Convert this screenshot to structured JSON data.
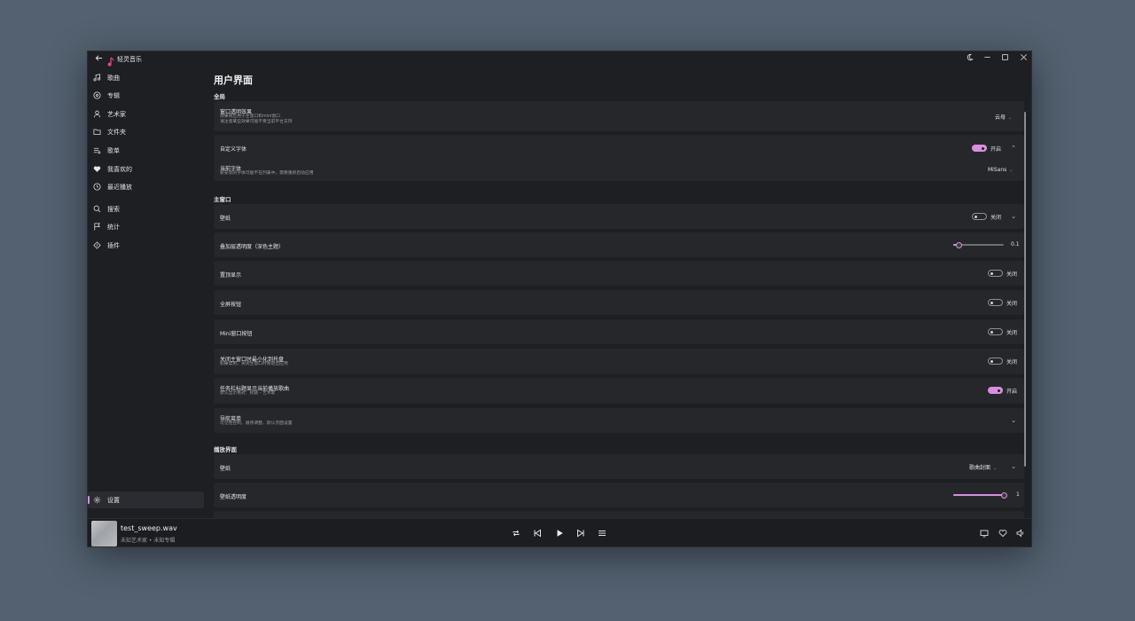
{
  "app": {
    "title": "轻灵音乐"
  },
  "sidebar": {
    "items": [
      {
        "label": "歌曲",
        "icon": "music-note-icon"
      },
      {
        "label": "专辑",
        "icon": "disc-icon"
      },
      {
        "label": "艺术家",
        "icon": "person-icon"
      },
      {
        "label": "文件夹",
        "icon": "folder-icon"
      },
      {
        "label": "歌单",
        "icon": "playlist-icon"
      },
      {
        "label": "我喜欢的",
        "icon": "heart-icon"
      },
      {
        "label": "最近播放",
        "icon": "history-icon"
      },
      {
        "label": "搜索",
        "icon": "search-icon"
      },
      {
        "label": "统计",
        "icon": "flag-icon"
      },
      {
        "label": "插件",
        "icon": "plugin-icon"
      }
    ],
    "settings_label": "设置"
  },
  "page": {
    "title": "用户界面"
  },
  "sections": {
    "global": "全局",
    "main_window": "主窗口",
    "player_ui": "播放界面"
  },
  "settings": {
    "window_effect": {
      "title": "窗口透明效果",
      "desc1": "效果将应用于主窗口和mini窗口",
      "desc2": "请注意某些效果可能不受当前平台支持",
      "value": "云母"
    },
    "custom_font": {
      "title": "自定义字体",
      "state": "开启",
      "on": true
    },
    "current_font": {
      "title": "当前字体",
      "desc": "新安装的字体可能不在列表中，需要重新启动应用",
      "value": "MiSans"
    },
    "wallpaper": {
      "title": "壁纸",
      "state": "关闭",
      "on": false
    },
    "overlay_opacity": {
      "title": "叠加层透明度（深色主题）",
      "value": "0.1",
      "fraction": 0.1
    },
    "always_on_top": {
      "title": "置顶显示",
      "state": "关闭",
      "on": false
    },
    "fullscreen_button": {
      "title": "全屏按钮",
      "state": "关闭",
      "on": false
    },
    "mini_button": {
      "title": "Mini窗口按钮",
      "state": "关闭",
      "on": false
    },
    "minimize_tray": {
      "title": "关闭主窗口时最小化到托盘",
      "desc": "如果禁用，关闭主窗口时将退出应用",
      "state": "关闭",
      "on": false
    },
    "taskbar_title": {
      "title": "任务栏标题显示当前播放歌曲",
      "desc": "默认显示格式：标题 - 艺术家",
      "state": "开启",
      "on": true
    },
    "nav_menu": {
      "title": "导航菜单",
      "desc": "可见性控制、顺序调整、默认页面设置"
    },
    "player_wallpaper": {
      "title": "壁纸",
      "value": "歌曲封面"
    },
    "wallpaper_opacity": {
      "title": "壁纸透明度",
      "value": "1",
      "fraction": 1.0
    }
  },
  "player": {
    "song_title": "test_sweep.wav",
    "song_sub": "未知艺术家 • 未知专辑"
  },
  "colors": {
    "accent": "#d88ee0",
    "bg": "#1e1f23",
    "card": "#26272b",
    "desktop": "#536170"
  }
}
